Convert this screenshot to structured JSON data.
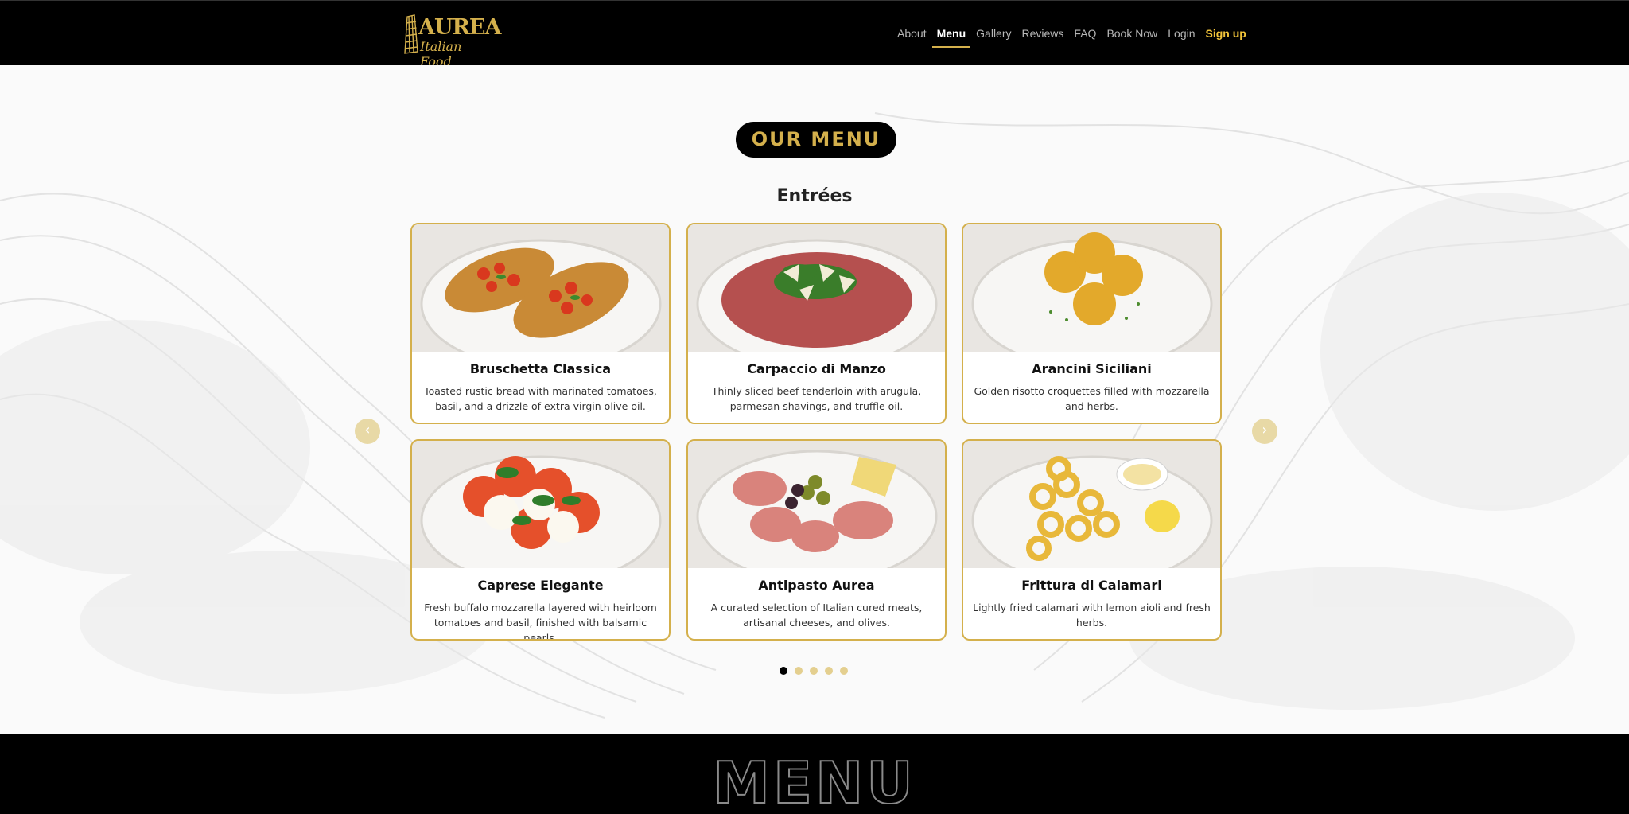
{
  "brand": {
    "name": "AUREA",
    "tagline": "Italian Food"
  },
  "nav": {
    "about": "About",
    "menu": "Menu",
    "gallery": "Gallery",
    "reviews": "Reviews",
    "faq": "FAQ",
    "book": "Book Now",
    "login": "Login",
    "signup": "Sign up"
  },
  "page": {
    "title": "OUR MENU",
    "section": "Entrées"
  },
  "cards": [
    {
      "name": "Bruschetta Classica",
      "desc": "Toasted rustic bread with marinated tomatoes, basil, and a drizzle of extra virgin olive oil."
    },
    {
      "name": "Carpaccio di Manzo",
      "desc": "Thinly sliced beef tenderloin with arugula, parmesan shavings, and truffle oil."
    },
    {
      "name": "Arancini Siciliani",
      "desc": "Golden risotto croquettes filled with mozzarella and herbs."
    },
    {
      "name": "Caprese Elegante",
      "desc": "Fresh buffalo mozzarella layered with heirloom tomatoes and basil, finished with balsamic pearls."
    },
    {
      "name": "Antipasto Aurea",
      "desc": "A curated selection of Italian cured meats, artisanal cheeses, and olives."
    },
    {
      "name": "Frittura di Calamari",
      "desc": "Lightly fried calamari with lemon aioli and fresh herbs."
    }
  ],
  "carousel": {
    "prev": "‹",
    "next": "›",
    "pages": 5,
    "active": 1
  },
  "footer": {
    "band_text": "MENU"
  },
  "colors": {
    "gold": "#d4b04c",
    "signup": "#f3c53a",
    "black": "#000000"
  }
}
